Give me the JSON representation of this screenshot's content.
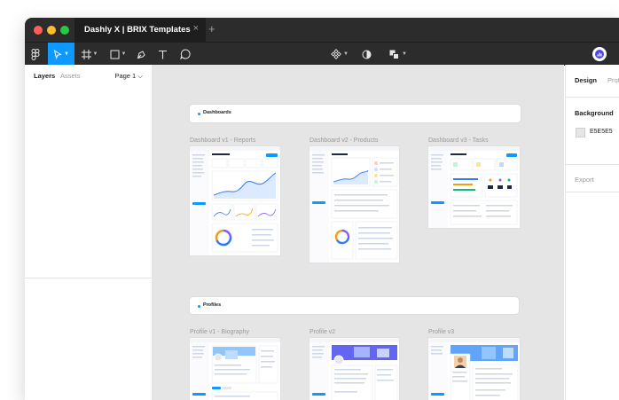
{
  "titlebar": {
    "tab_title": "Dashly X | BRIX Templates",
    "tab_close": "×",
    "new_tab": "+"
  },
  "toolbar": {
    "tools": [
      "main-menu",
      "move",
      "frame",
      "shape",
      "pen",
      "text",
      "comment"
    ],
    "center_tools": [
      "components",
      "theme-toggle",
      "fill"
    ]
  },
  "left_panel": {
    "tab_layers": "Layers",
    "tab_assets": "Assets",
    "page_selector": "Page 1 ⌵"
  },
  "canvas": {
    "sections": [
      {
        "label": "Dashboards"
      },
      {
        "label": "Profiles"
      }
    ],
    "frames": [
      {
        "label": "Dashboard v1 - Reports"
      },
      {
        "label": "Dashboard v2 - Products"
      },
      {
        "label": "Dashboard v3 - Tasks"
      },
      {
        "label": "Profile v1 - Biography"
      },
      {
        "label": "Profile v2"
      },
      {
        "label": "Profile v3"
      }
    ]
  },
  "right_panel": {
    "tab_design": "Design",
    "tab_prototype": "Prototype",
    "background_label": "Background",
    "background_hex": "E5E5E5",
    "export_label": "Export"
  },
  "colors": {
    "accent": "#0d99ff",
    "chrome": "#2c2c2c",
    "canvas_bg": "#e5e5e5"
  }
}
